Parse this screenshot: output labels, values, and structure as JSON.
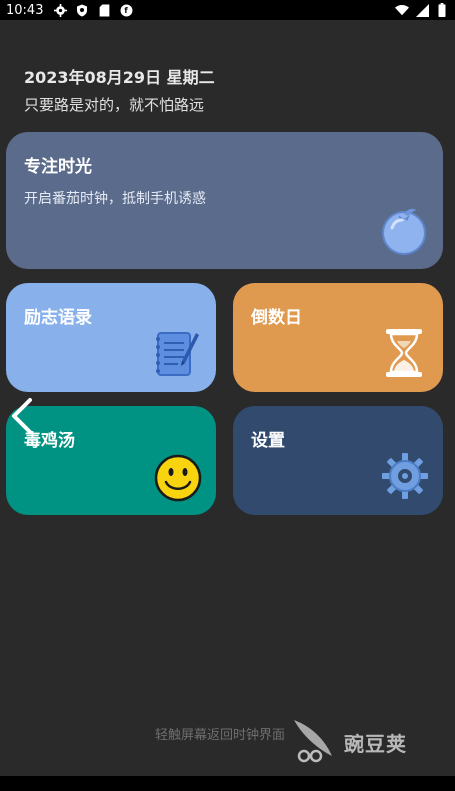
{
  "status_bar": {
    "time": "10:43",
    "icons": [
      "settings-gear-icon",
      "shield-icon",
      "sd-card-icon",
      "app-f-icon"
    ],
    "right_icons": [
      "wifi-icon",
      "signal-icon",
      "battery-icon"
    ]
  },
  "header": {
    "date": "2023年08月29日 星期二",
    "motto": "只要路是对的，就不怕路远"
  },
  "cards": {
    "focus": {
      "title": "专注时光",
      "subtitle": "开启番茄时钟，抵制手机诱惑",
      "icon": "tomato-icon",
      "color": "#5b6b8c"
    },
    "quotes": {
      "title": "励志语录",
      "icon": "notepad-icon",
      "color": "#88b1ec"
    },
    "countdown": {
      "title": "倒数日",
      "icon": "hourglass-icon",
      "color": "#df9a4f"
    },
    "soup": {
      "title": "毒鸡汤",
      "icon": "smiley-icon",
      "color": "#009282"
    },
    "settings": {
      "title": "设置",
      "icon": "gear-icon",
      "color": "#314a6d"
    }
  },
  "footer": {
    "hint": "轻触屏幕返回时钟界面",
    "watermark": "豌豆荚"
  },
  "colors": {
    "background": "#2a2a2a"
  }
}
